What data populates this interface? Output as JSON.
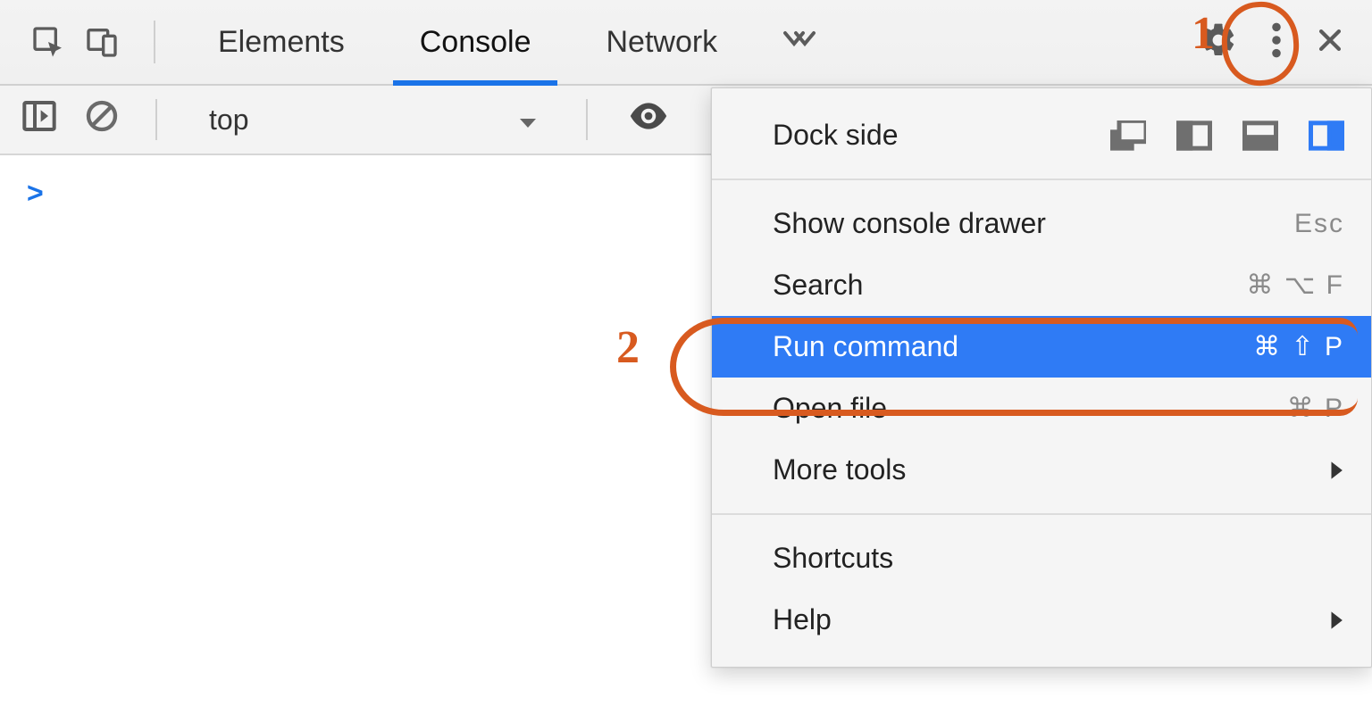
{
  "toolbar": {
    "tabs": [
      {
        "label": "Elements"
      },
      {
        "label": "Console"
      },
      {
        "label": "Network"
      }
    ],
    "active_tab_index": 1
  },
  "subbar": {
    "context_label": "top"
  },
  "console": {
    "prompt": ">"
  },
  "menu": {
    "dock_label": "Dock side",
    "items": [
      {
        "label": "Show console drawer",
        "shortcut": "Esc"
      },
      {
        "label": "Search",
        "shortcut": "⌘ ⌥ F"
      },
      {
        "label": "Run command",
        "shortcut": "⌘ ⇧ P"
      },
      {
        "label": "Open file",
        "shortcut": "⌘ P"
      },
      {
        "label": "More tools",
        "submenu": true
      }
    ],
    "highlighted_index": 2,
    "footer_items": [
      {
        "label": "Shortcuts"
      },
      {
        "label": "Help",
        "submenu": true
      }
    ]
  },
  "annotations": {
    "label1": "1",
    "label2": "2"
  }
}
